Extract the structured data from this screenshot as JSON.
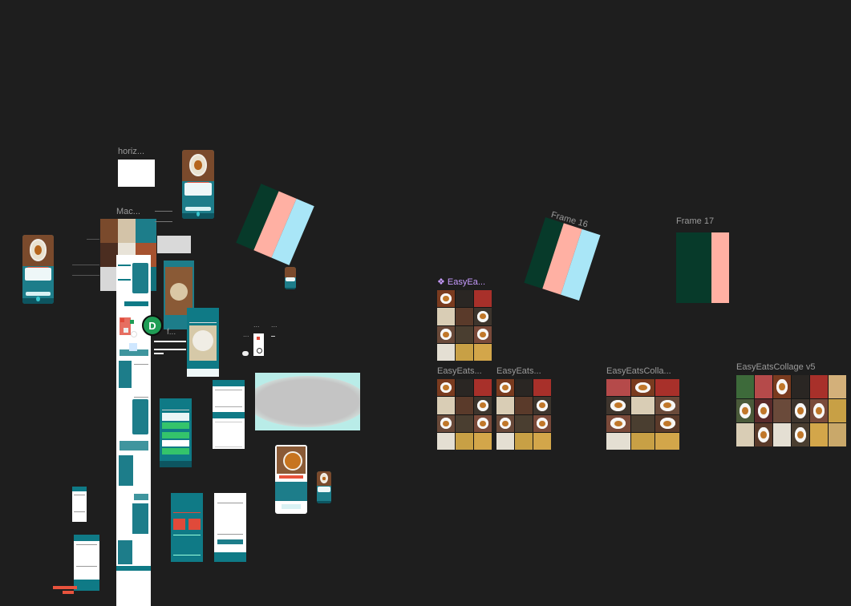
{
  "canvas": {
    "background": "#1e1e1e",
    "labels": {
      "horiz": "horiz...",
      "mac": "Mac...",
      "easyeats_component": "❖ EasyEa...",
      "easyeats_a": "EasyEats...",
      "easyeats_b": "EasyEats...",
      "easyeats_colla": "EasyEatsColla...",
      "collage_v5": "EasyEatsCollage v5",
      "frame16": "Frame 16",
      "frame17": "Frame 17",
      "small_f": "f...",
      "dots_a": "...",
      "dots_b": "...",
      "dots_c": "...",
      "dots_d": "..."
    },
    "presence": {
      "initial": "D",
      "color": "#1f9d55"
    },
    "stripe_colors": {
      "dark": "#073a2a",
      "pink": "#ffb0a3",
      "blue": "#a9e6f7"
    },
    "accent": "#0f7a86"
  }
}
